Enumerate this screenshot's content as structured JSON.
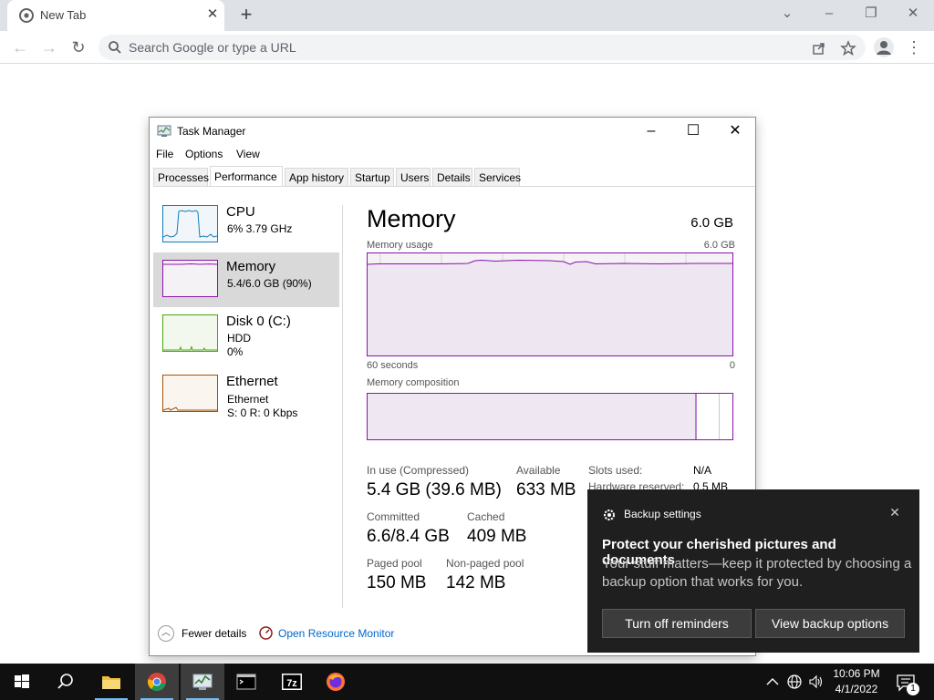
{
  "browser": {
    "tab_title": "New Tab",
    "tab_close_icon": "close-icon",
    "new_tab_icon": "plus-icon",
    "omnibox_placeholder": "Search Google or type a URL",
    "icons": [
      "chrome-icon",
      "back-icon",
      "forward-icon",
      "reload-icon",
      "search-icon",
      "share-icon",
      "star-icon",
      "profile-icon",
      "menu-icon"
    ]
  },
  "task_manager": {
    "title": "Task Manager",
    "menu": [
      "File",
      "Options",
      "View"
    ],
    "tabs": [
      "Processes",
      "Performance",
      "App history",
      "Startup",
      "Users",
      "Details",
      "Services"
    ],
    "active_tab": "Performance",
    "resources": [
      {
        "name": "CPU",
        "line1": "6% 3.79 GHz",
        "line2": "",
        "color": "#117dbb"
      },
      {
        "name": "Memory",
        "line1": "5.4/6.0 GB (90%)",
        "line2": "",
        "color": "#8b12ae"
      },
      {
        "name": "Disk 0 (C:)",
        "line1": "HDD",
        "line2": "0%",
        "color": "#4da60c"
      },
      {
        "name": "Ethernet",
        "line1": "Ethernet",
        "line2": "S: 0 R: 0 Kbps",
        "color": "#a74f01"
      }
    ],
    "memory": {
      "title": "Memory",
      "total": "6.0 GB",
      "usage_label": "Memory usage",
      "usage_max": "6.0 GB",
      "axis_left": "60 seconds",
      "axis_right": "0",
      "composition_label": "Memory composition",
      "usage_fraction": 0.9,
      "in_use_label": "In use (Compressed)",
      "in_use_value": "5.4 GB (39.6 MB)",
      "available_label": "Available",
      "available_value": "633 MB",
      "slots_label": "Slots used:",
      "slots_value": "N/A",
      "hw_reserved_label": "Hardware reserved:",
      "hw_reserved_value": "0.5 MB",
      "committed_label": "Committed",
      "committed_value": "6.6/8.4 GB",
      "cached_label": "Cached",
      "cached_value": "409 MB",
      "paged_label": "Paged pool",
      "paged_value": "150 MB",
      "nonpaged_label": "Non-paged pool",
      "nonpaged_value": "142 MB"
    },
    "footer": {
      "fewer_details": "Fewer details",
      "resource_monitor": "Open Resource Monitor"
    }
  },
  "toast": {
    "app_name": "Backup settings",
    "headline": "Protect your cherished pictures and documents",
    "body": "Your stuff matters—keep it protected by choosing a backup option that works for you.",
    "button1": "Turn off reminders",
    "button2": "View backup options"
  },
  "taskbar": {
    "time": "10:06 PM",
    "date": "4/1/2022",
    "notification_count": "1",
    "apps": [
      "start-icon",
      "search-icon",
      "file-explorer-icon",
      "chrome-icon",
      "task-manager-icon",
      "terminal-icon",
      "7zip-icon",
      "firefox-icon"
    ]
  }
}
